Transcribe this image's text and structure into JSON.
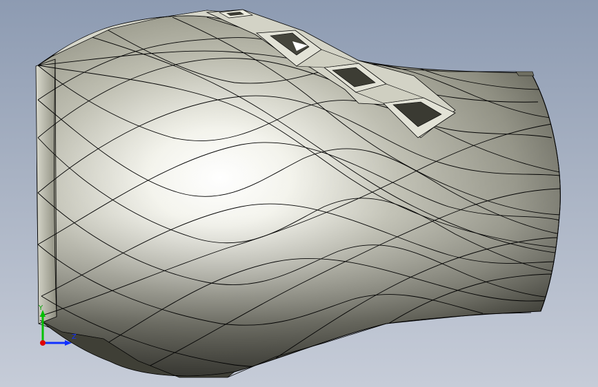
{
  "viewport": {
    "background_top": "#8d9bb2",
    "background_bottom": "#c6ccd8"
  },
  "model": {
    "surface_color": "#c9c9bc",
    "highlight_color": "#ffffff",
    "shadow_color": "#3f3f36",
    "edge_color": "#000000",
    "pocket_count": 4
  },
  "triad": {
    "y_label": "Y",
    "z_label": "Z",
    "y_color": "#00c000",
    "z_color": "#1030ff",
    "x_color": "#e00000"
  }
}
